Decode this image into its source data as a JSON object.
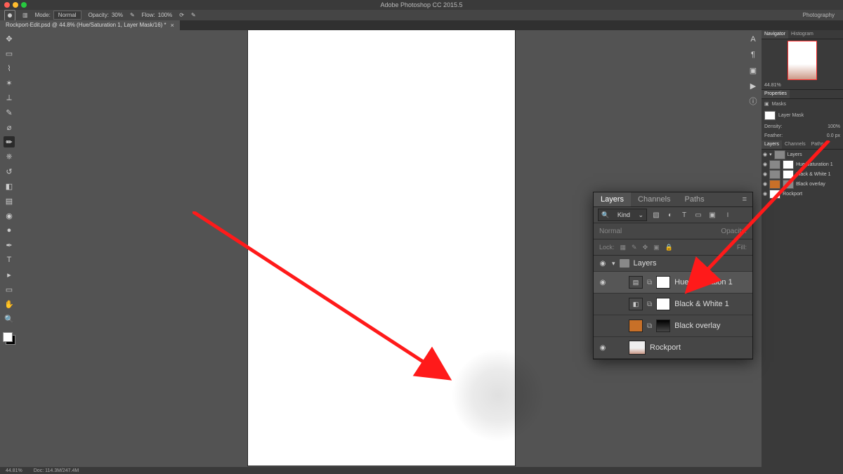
{
  "app": {
    "title": "Adobe Photoshop CC 2015.5",
    "workspace": "Photography"
  },
  "optionbar": {
    "mode_label": "Mode:",
    "mode_value": "Normal",
    "opacity_label": "Opacity:",
    "opacity_value": "30%",
    "flow_label": "Flow:",
    "flow_value": "100%"
  },
  "document": {
    "tab": "Rockport-Edit.psd @ 44.8% (Hue/Saturation 1, Layer Mask/16) *"
  },
  "status": {
    "zoom": "44.81%",
    "docinfo": "Doc: 114.3M/247.4M"
  },
  "navigator": {
    "tab1": "Navigator",
    "tab2": "Histogram",
    "zoom": "44.81%"
  },
  "properties": {
    "heading": "Properties",
    "type": "Masks",
    "layermask": "Layer Mask",
    "density_label": "Density:",
    "density_value": "100%",
    "feather_label": "Feather:",
    "feather_value": "0.0 px"
  },
  "minilayers": {
    "tabs": [
      "Layers",
      "Channels",
      "Paths"
    ],
    "items": [
      {
        "name": "Layers"
      },
      {
        "name": "Hue/Saturation 1"
      },
      {
        "name": "Black & White 1"
      },
      {
        "name": "Black overlay"
      },
      {
        "name": "Rockport"
      }
    ]
  },
  "layerspanel": {
    "tabs": {
      "layers": "Layers",
      "channels": "Channels",
      "paths": "Paths"
    },
    "kind_label": "Kind",
    "blend": "Normal",
    "opacity_label": "Opacity:",
    "lock_label": "Lock:",
    "fill_label": "Fill:",
    "group": "Layers",
    "items": [
      {
        "name": "Hue/Saturation 1"
      },
      {
        "name": "Black & White 1"
      },
      {
        "name": "Black overlay"
      },
      {
        "name": "Rockport"
      }
    ]
  }
}
